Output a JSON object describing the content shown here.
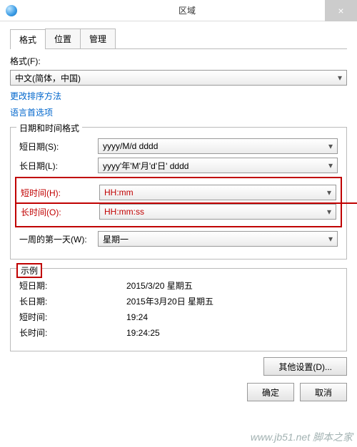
{
  "window": {
    "title": "区域",
    "close": "×"
  },
  "tabs": {
    "format": "格式",
    "location": "位置",
    "admin": "管理"
  },
  "format": {
    "label": "格式(F):",
    "value": "中文(简体，中国)",
    "sort_link": "更改排序方法",
    "lang_link": "语言首选项"
  },
  "dt": {
    "legend": "日期和时间格式",
    "short_date_l": "短日期(S):",
    "short_date_v": "yyyy/M/d dddd",
    "long_date_l": "长日期(L):",
    "long_date_v": "yyyy'年'M'月'd'日' dddd",
    "short_time_l": "短时间(H):",
    "short_time_v": "HH:mm",
    "long_time_l": "长时间(O):",
    "long_time_v": "HH:mm:ss",
    "first_day_l": "一周的第一天(W):",
    "first_day_v": "星期一"
  },
  "ex": {
    "legend": "示例",
    "sd_l": "短日期:",
    "sd_v": "2015/3/20 星期五",
    "ld_l": "长日期:",
    "ld_v": "2015年3月20日 星期五",
    "st_l": "短时间:",
    "st_v": "19:24",
    "lt_l": "长时间:",
    "lt_v": "19:24:25"
  },
  "buttons": {
    "other": "其他设置(D)...",
    "ok": "确定",
    "cancel": "取消"
  },
  "watermark": "www.jb51.net 脚本之家"
}
